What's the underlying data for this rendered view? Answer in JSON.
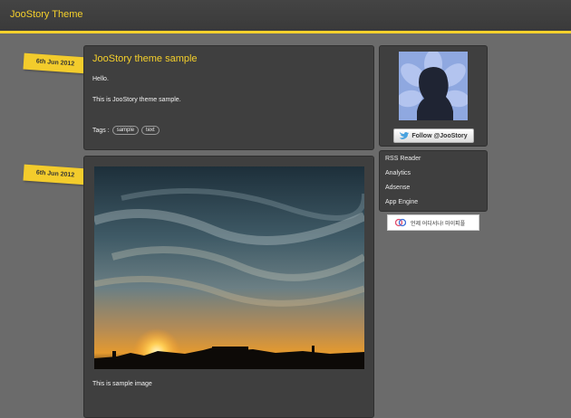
{
  "header": {
    "site_title": "JooStory Theme"
  },
  "posts": [
    {
      "date": "6th Jun 2012",
      "title": "JooStory theme sample",
      "paragraphs": [
        "Hello.",
        "This is JooStory theme sample."
      ],
      "tags_label": "Tags :",
      "tags": [
        "sample",
        "text"
      ]
    },
    {
      "date": "6th Jun 2012",
      "image_alt": "sunset sky photo",
      "caption": "This is sample image"
    }
  ],
  "sidebar": {
    "follow_label": "Follow @JooStory",
    "links": [
      "RSS Reader",
      "Analytics",
      "Adsense",
      "App Engine"
    ],
    "badge_text": "언제 어디서나! 마이피플"
  },
  "colors": {
    "accent": "#f5d02b",
    "background": "#6b6b6b",
    "panel": "#3f3f3f",
    "header": "#3d3d3d"
  }
}
